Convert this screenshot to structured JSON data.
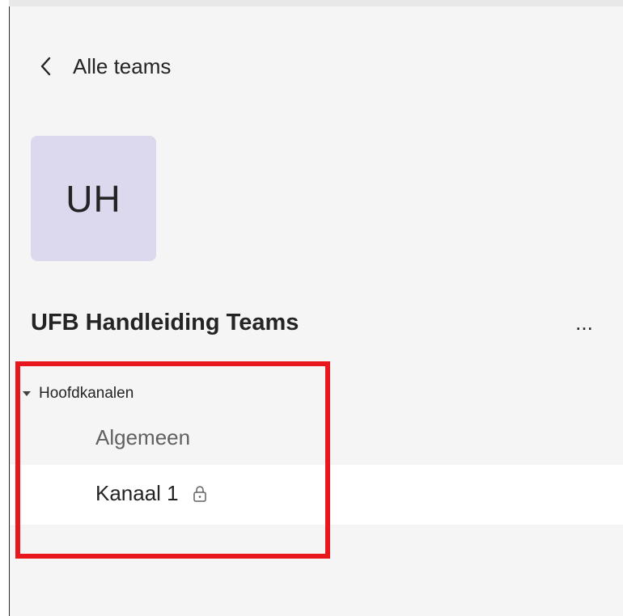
{
  "navigation": {
    "back_label": "Alle teams",
    "back_icon": "chevron-left-icon"
  },
  "team": {
    "avatar_initials": "UH",
    "avatar_color": "#dcd9ef",
    "name": "UFB Handleiding Teams",
    "more_label": "..."
  },
  "channels": {
    "section_label": "Hoofdkanalen",
    "section_icon": "caret-down-icon",
    "items": [
      {
        "label": "Algemeen",
        "selected": false
      },
      {
        "label": "Kanaal 1",
        "selected": true,
        "icon": "lock-icon"
      }
    ]
  },
  "annotation": {
    "highlight_color": "#e8161d"
  }
}
